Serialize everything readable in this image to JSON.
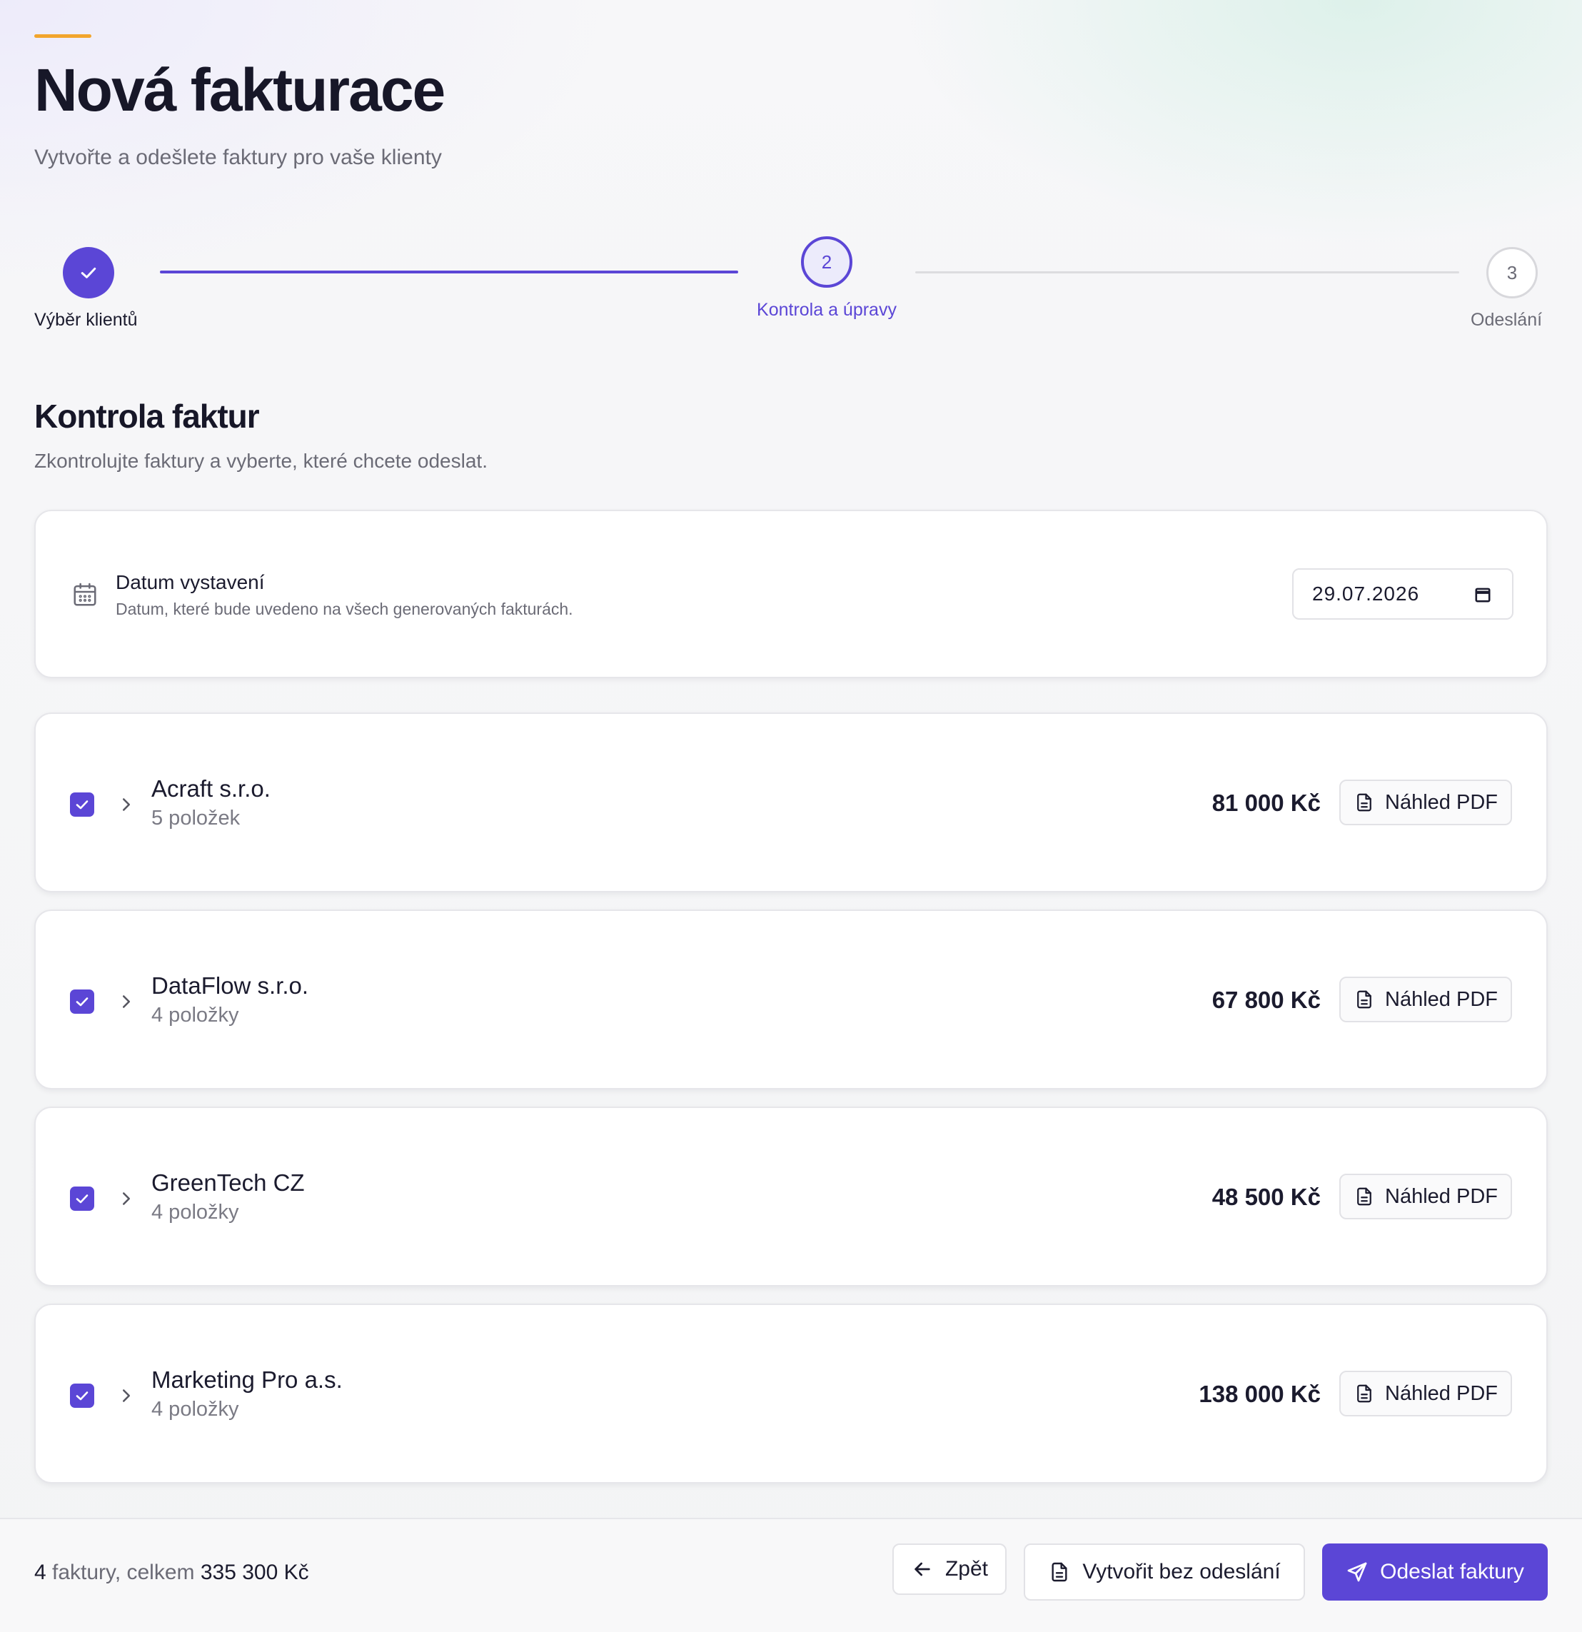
{
  "header": {
    "title": "Nová fakturace",
    "subtitle": "Vytvořte a odešlete faktury pro vaše klienty"
  },
  "stepper": {
    "steps": [
      {
        "number": "1",
        "label": "Výběr klientů",
        "status": "completed"
      },
      {
        "number": "2",
        "label": "Kontrola a úpravy",
        "status": "active"
      },
      {
        "number": "3",
        "label": "Odeslání",
        "status": "pending"
      }
    ]
  },
  "section": {
    "title": "Kontrola faktur",
    "subtitle": "Zkontrolujte faktury a vyberte, které chcete odeslat."
  },
  "issue_date": {
    "title": "Datum vystavení",
    "description": "Datum, které bude uvedeno na všech generovaných fakturách.",
    "value": "29.07.2026"
  },
  "invoices": [
    {
      "client": "Acraft s.r.o.",
      "items": "5 položek",
      "amount": "81 000 Kč",
      "checked": true,
      "pdf_label": "Náhled PDF"
    },
    {
      "client": "DataFlow s.r.o.",
      "items": "4 položky",
      "amount": "67 800 Kč",
      "checked": true,
      "pdf_label": "Náhled PDF"
    },
    {
      "client": "GreenTech CZ",
      "items": "4 položky",
      "amount": "48 500 Kč",
      "checked": true,
      "pdf_label": "Náhled PDF"
    },
    {
      "client": "Marketing Pro a.s.",
      "items": "4 položky",
      "amount": "138 000 Kč",
      "checked": true,
      "pdf_label": "Náhled PDF"
    }
  ],
  "footer": {
    "count": "4",
    "count_suffix": " faktury, celkem ",
    "total": "335 300 Kč",
    "back_label": "Zpět",
    "create_label": "Vytvořit bez odeslání",
    "send_label": "Odeslat faktury"
  },
  "colors": {
    "accent": "#5b46d6",
    "highlight": "#f2a52c"
  }
}
